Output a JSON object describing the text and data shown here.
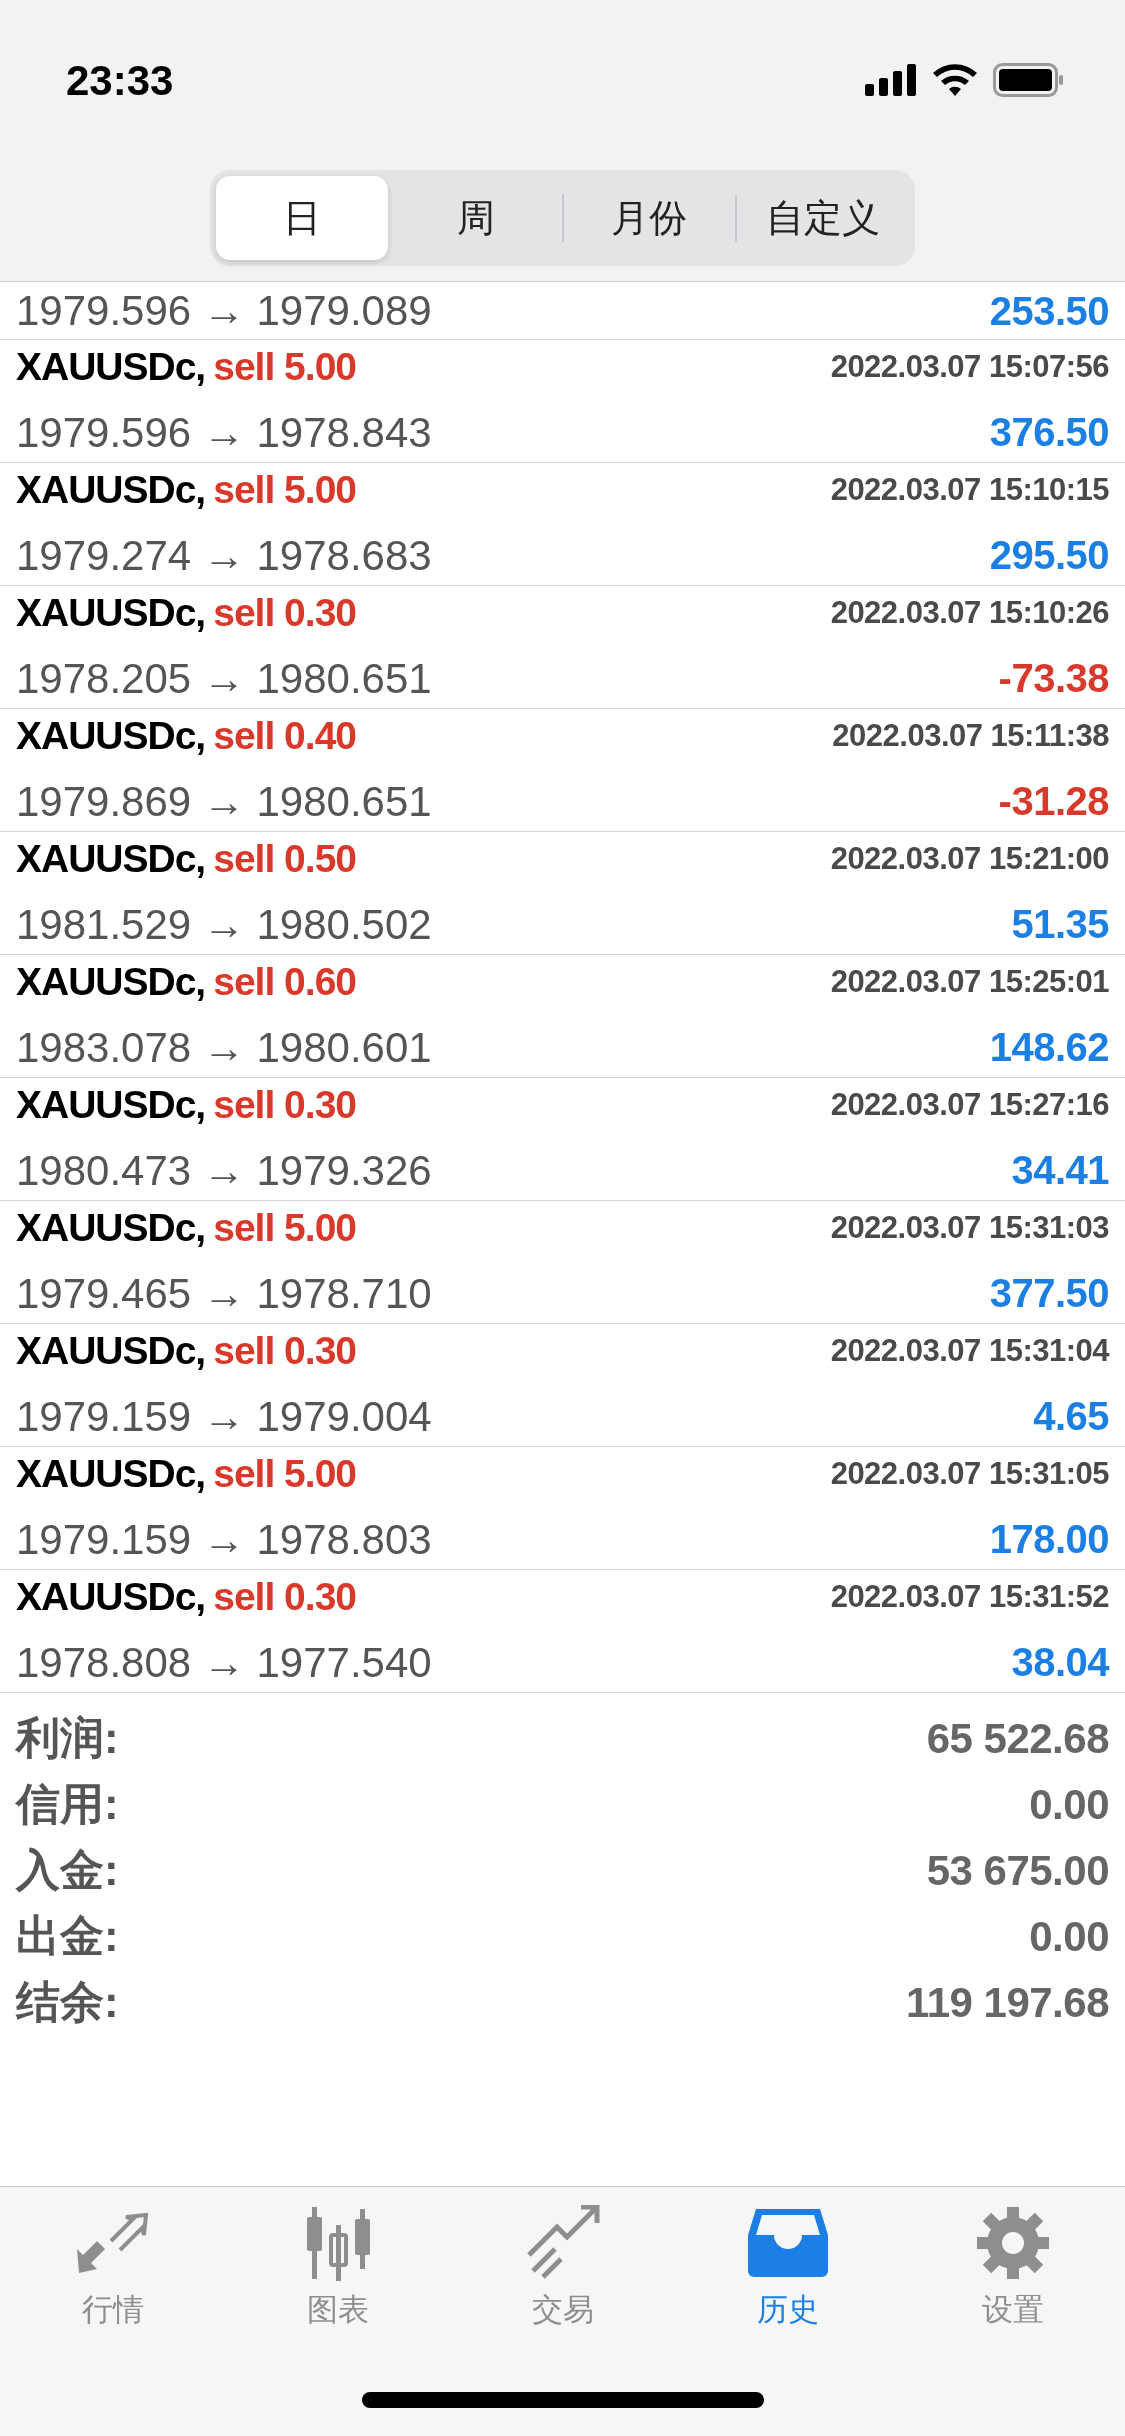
{
  "status_bar": {
    "time": "23:33"
  },
  "segments": [
    {
      "label": "日",
      "selected": true
    },
    {
      "label": "周",
      "selected": false
    },
    {
      "label": "月份",
      "selected": false
    },
    {
      "label": "自定义",
      "selected": false
    }
  ],
  "partial_row": {
    "prices": "1979.596 → 1979.089",
    "profit": "253.50",
    "color": "#1b7fe3"
  },
  "trades": [
    {
      "symbol": "XAUUSDc,",
      "side": "sell 5.00",
      "time": "2022.03.07 15:07:56",
      "prices": "1979.596 → 1978.843",
      "profit": "376.50",
      "color": "#1b7fe3"
    },
    {
      "symbol": "XAUUSDc,",
      "side": "sell 5.00",
      "time": "2022.03.07 15:10:15",
      "prices": "1979.274 → 1978.683",
      "profit": "295.50",
      "color": "#1b7fe3"
    },
    {
      "symbol": "XAUUSDc,",
      "side": "sell 0.30",
      "time": "2022.03.07 15:10:26",
      "prices": "1978.205 → 1980.651",
      "profit": "-73.38",
      "color": "#d9392b"
    },
    {
      "symbol": "XAUUSDc,",
      "side": "sell 0.40",
      "time": "2022.03.07 15:11:38",
      "prices": "1979.869 → 1980.651",
      "profit": "-31.28",
      "color": "#d9392b"
    },
    {
      "symbol": "XAUUSDc,",
      "side": "sell 0.50",
      "time": "2022.03.07 15:21:00",
      "prices": "1981.529 → 1980.502",
      "profit": "51.35",
      "color": "#1b7fe3"
    },
    {
      "symbol": "XAUUSDc,",
      "side": "sell 0.60",
      "time": "2022.03.07 15:25:01",
      "prices": "1983.078 → 1980.601",
      "profit": "148.62",
      "color": "#1b7fe3"
    },
    {
      "symbol": "XAUUSDc,",
      "side": "sell 0.30",
      "time": "2022.03.07 15:27:16",
      "prices": "1980.473 → 1979.326",
      "profit": "34.41",
      "color": "#1b7fe3"
    },
    {
      "symbol": "XAUUSDc,",
      "side": "sell 5.00",
      "time": "2022.03.07 15:31:03",
      "prices": "1979.465 → 1978.710",
      "profit": "377.50",
      "color": "#1b7fe3"
    },
    {
      "symbol": "XAUUSDc,",
      "side": "sell 0.30",
      "time": "2022.03.07 15:31:04",
      "prices": "1979.159 → 1979.004",
      "profit": "4.65",
      "color": "#1b7fe3"
    },
    {
      "symbol": "XAUUSDc,",
      "side": "sell 5.00",
      "time": "2022.03.07 15:31:05",
      "prices": "1979.159 → 1978.803",
      "profit": "178.00",
      "color": "#1b7fe3"
    },
    {
      "symbol": "XAUUSDc,",
      "side": "sell 0.30",
      "time": "2022.03.07 15:31:52",
      "prices": "1978.808 → 1977.540",
      "profit": "38.04",
      "color": "#1b7fe3"
    }
  ],
  "summary": [
    {
      "label": "利润:",
      "value": "65 522.68"
    },
    {
      "label": "信用:",
      "value": "0.00"
    },
    {
      "label": "入金:",
      "value": "53 675.00"
    },
    {
      "label": "出金:",
      "value": "0.00"
    },
    {
      "label": "结余:",
      "value": "119 197.68"
    }
  ],
  "tab_bar": [
    {
      "kind": "quotes",
      "label": "行情",
      "selected": false
    },
    {
      "kind": "chart",
      "label": "图表",
      "selected": false
    },
    {
      "kind": "trade",
      "label": "交易",
      "selected": false
    },
    {
      "kind": "history",
      "label": "历史",
      "selected": true
    },
    {
      "kind": "settings",
      "label": "设置",
      "selected": false
    }
  ]
}
